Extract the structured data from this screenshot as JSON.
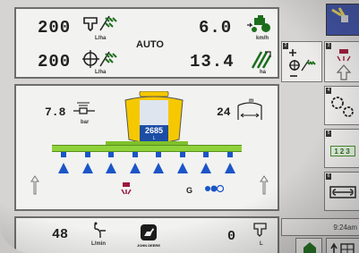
{
  "top": {
    "rate_target": "200",
    "rate_target_unit": "L/ha",
    "rate_actual": "200",
    "rate_actual_unit": "L/ha",
    "mode": "AUTO",
    "speed": "6.0",
    "speed_unit": "km/h",
    "area": "13.4",
    "area_unit": "ha"
  },
  "sprayer": {
    "pressure": "7.8",
    "pressure_unit": "bar",
    "boom_width": "24",
    "boom_width_unit": "m",
    "tank_volume": "2685",
    "tank_unit": "L",
    "section_count": 8,
    "gear": "G"
  },
  "bottom": {
    "flow": "48",
    "flow_unit": "L/min",
    "brand": "JOHN DEERE",
    "tank_remaining": "0",
    "tank_remaining_unit": "L"
  },
  "sidebar": {
    "clock": "9:24am",
    "keys": [
      "2",
      "3",
      "4",
      "5",
      "6",
      "7"
    ],
    "number_strip": "123"
  },
  "colors": {
    "boom_green": "#8fd23b",
    "nozzle_blue": "#1b55c7",
    "tank_yellow": "#f5c800",
    "tank_blue": "#1c4ea6"
  }
}
